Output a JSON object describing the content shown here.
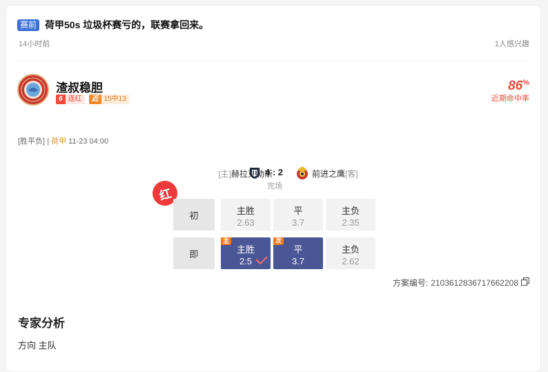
{
  "post": {
    "tag": "赛前",
    "title": "荷甲50s 垃圾杯赛亏的，联赛拿回来。",
    "time": "14小时前",
    "interest": "1人感兴趣"
  },
  "author": {
    "name": "渣叔稳胆",
    "streak_num": "6",
    "streak_label": "连红",
    "recent_num": "近",
    "recent_label": "15中13",
    "hit_rate": "86",
    "hit_rate_unit": "%",
    "hit_rate_label": "近期命中率"
  },
  "match": {
    "type": "[胜平负]",
    "separator": "|",
    "league": "荷甲",
    "datetime": "11-23 04:00",
    "home_side": "[主]",
    "home_team": "赫拉克勒斯",
    "score": "4 : 2",
    "status": "完场",
    "away_team": "前进之鹰",
    "away_side": "[客]"
  },
  "result_stamp": "红",
  "odds": {
    "initial_label": "初",
    "live_label": "即",
    "initial": [
      {
        "name": "主胜",
        "odd": "2.63"
      },
      {
        "name": "平",
        "odd": "3.7"
      },
      {
        "name": "主负",
        "odd": "2.35"
      }
    ],
    "live": [
      {
        "name": "主胜",
        "odd": "2.5",
        "corner": "主"
      },
      {
        "name": "平",
        "odd": "3.7",
        "corner": "次"
      },
      {
        "name": "主负",
        "odd": "2.62"
      }
    ]
  },
  "plan": {
    "label": "方案编号:",
    "id": "2103612836717662208"
  },
  "analysis": {
    "heading": "专家分析",
    "direction": "方向 主队"
  },
  "colors": {
    "accent_blue": "#3b6fd8",
    "selected": "#4a5796",
    "red": "#e94a3a",
    "orange": "#f07a1a"
  }
}
